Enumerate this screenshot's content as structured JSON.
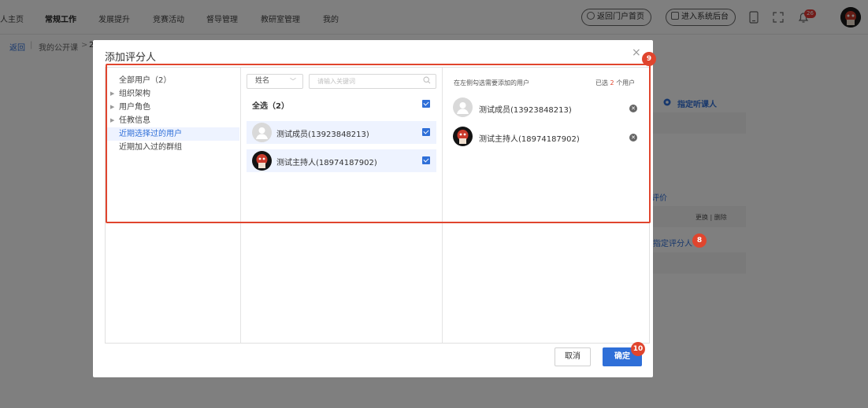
{
  "topnav": {
    "items": [
      "人主页",
      "常规工作",
      "发展提升",
      "竞赛活动",
      "督导管理",
      "教研室管理",
      "我的"
    ],
    "portal_button": "返回门户首页",
    "system_button": "进入系统后台",
    "notification_count": "26"
  },
  "breadcrumb": {
    "back": "返回",
    "current": "我的公开课",
    "sep": ">",
    "tail": "2"
  },
  "background": {
    "assign_listener": "指定听课人",
    "evaluate": "评价",
    "change_delete": "更换 | 删除",
    "assign_evaluator": "指定评分人",
    "step8": "8"
  },
  "modal": {
    "title": "添加评分人",
    "close": "×",
    "tree": {
      "all_users": "全部用户（2）",
      "org": "组织架构",
      "roles": "用户角色",
      "teaching": "任教信息",
      "recent_users": "近期选择过的用户",
      "recent_groups": "近期加入过的群组"
    },
    "filter": {
      "field": "姓名",
      "placeholder": "请输入关键词"
    },
    "select_all": "全选（2）",
    "users": [
      {
        "name": "测试成员(13923848213)"
      },
      {
        "name": "测试主持人(18974187902)"
      }
    ],
    "right": {
      "hint": "在左侧勾选需要添加的用户",
      "selected_prefix": "已选",
      "selected_count": "2",
      "selected_suffix": "个用户"
    },
    "cancel": "取消",
    "confirm": "确定"
  },
  "steps": {
    "nine": "9",
    "ten": "10"
  },
  "colors": {
    "primary": "#2f6fd8",
    "highlight": "#e0452e"
  }
}
